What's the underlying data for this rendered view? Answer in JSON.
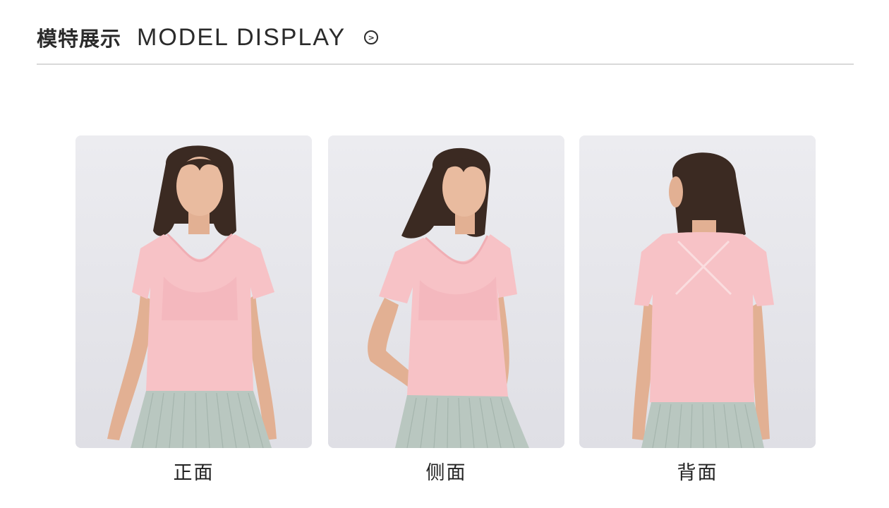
{
  "header": {
    "title_cn": "模特展示",
    "title_en": "MODEL DISPLAY",
    "arrow_icon": "arrow-right-circle-icon"
  },
  "colors": {
    "background": "#ffffff",
    "text": "#2b2b2b",
    "divider": "#d9d9d9",
    "photo_backdrop": "#e6e6eb",
    "shirt": "#f7c2c6",
    "skirt": "#b9c7c0",
    "hair": "#3b2a22",
    "skin": "#e7b89c"
  },
  "gallery": {
    "items": [
      {
        "caption": "正面",
        "view": "front"
      },
      {
        "caption": "侧面",
        "view": "side"
      },
      {
        "caption": "背面",
        "view": "back"
      }
    ]
  }
}
